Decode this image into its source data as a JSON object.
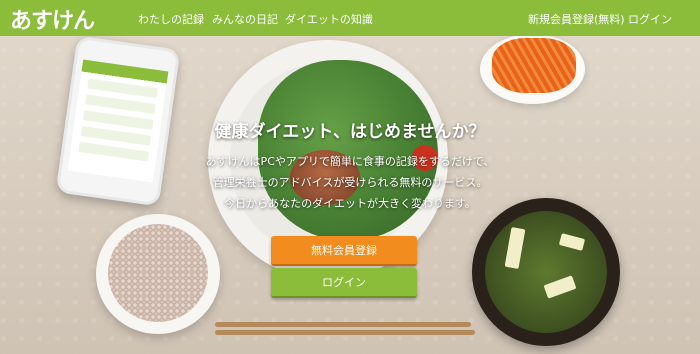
{
  "brand": {
    "logo_text": "あすけん",
    "color": "#8bbd3b"
  },
  "nav": {
    "links": [
      "わたしの記録",
      "みんなの日記",
      "ダイエットの知識"
    ],
    "register": "新規会員登録(無料)",
    "login": "ログイン"
  },
  "hero": {
    "headline": "健康ダイエット、はじめませんか？",
    "lines": [
      "あすけんはPCやアプリで簡単に食事の記録をするだけで、",
      "管理栄養士のアドバイスが受けられる無料のサービス。",
      "今日からあなたのダイエットが大きく変わります。"
    ]
  },
  "buttons": {
    "register": "無料会員登録",
    "login": "ログイン",
    "register_color": "#f28c1e",
    "login_color": "#8bbd3b"
  }
}
